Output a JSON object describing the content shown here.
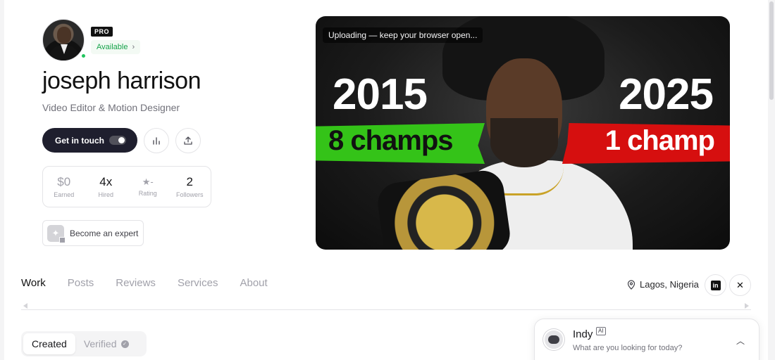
{
  "profile": {
    "badge": "PRO",
    "availability": "Available",
    "name": "joseph harrison",
    "role": "Video Editor & Motion Designer",
    "cta_label": "Get in touch",
    "become_expert_label": "Become an expert",
    "online": true
  },
  "stats": [
    {
      "value": "$0",
      "label": "Earned"
    },
    {
      "value": "4x",
      "label": "Hired"
    },
    {
      "value": "★-",
      "label": "Rating"
    },
    {
      "value": "2",
      "label": "Followers"
    }
  ],
  "hero": {
    "status": "Uploading — keep your browser open...",
    "year_left": "2015",
    "year_right": "2025",
    "caption_left": "8 champs",
    "caption_right": "1 champ",
    "colors": {
      "left_band": "#34c318",
      "right_band": "#d60f0f"
    }
  },
  "tabs": [
    "Work",
    "Posts",
    "Reviews",
    "Services",
    "About"
  ],
  "active_tab": "Work",
  "location": "Lagos, Nigeria",
  "social": [
    "linkedin-icon",
    "x-icon"
  ],
  "filter": {
    "options": [
      "Created",
      "Verified"
    ],
    "selected": "Created"
  },
  "chat": {
    "title": "Indy",
    "badge": "AI",
    "subtitle": "What are you looking for today?"
  }
}
